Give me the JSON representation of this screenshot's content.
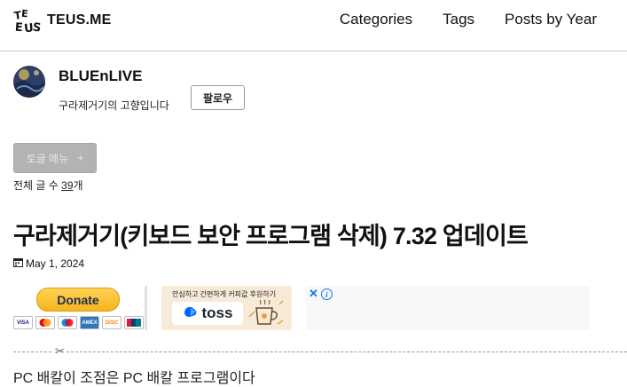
{
  "header": {
    "logo_text": "TEUS.ME",
    "nav": [
      "Categories",
      "Tags",
      "Posts by Year"
    ]
  },
  "profile": {
    "name": "BLUEnLIVE",
    "description": "구라제거기의 고향입니다",
    "follow_label": "팔로우"
  },
  "toggle_menu": {
    "label": "토글 메뉴",
    "plus": "+"
  },
  "post_count": {
    "prefix": "전체 글 수 ",
    "count": "39",
    "suffix": "개"
  },
  "post": {
    "title": "구라제거기(키보드 보안 프로그램 삭제) 7.32 업데이트",
    "date": "May 1, 2024",
    "body_preview": "PC 배칼이 조점은 PC 배칼 프로그램이다"
  },
  "donate": {
    "paypal_label": "Donate",
    "cards": [
      "VISA",
      "MC",
      "MAE",
      "AMEX",
      "DISC",
      "UP"
    ]
  },
  "toss": {
    "caption": "안심하고 간편하게 커피값 후원하기",
    "brand": "toss"
  },
  "ad": {
    "close": "✕",
    "info": "i"
  },
  "colors": {
    "accent": "#0064ff",
    "paypal_yellow": "#ffc439",
    "toss_bg": "#f7ead9"
  }
}
